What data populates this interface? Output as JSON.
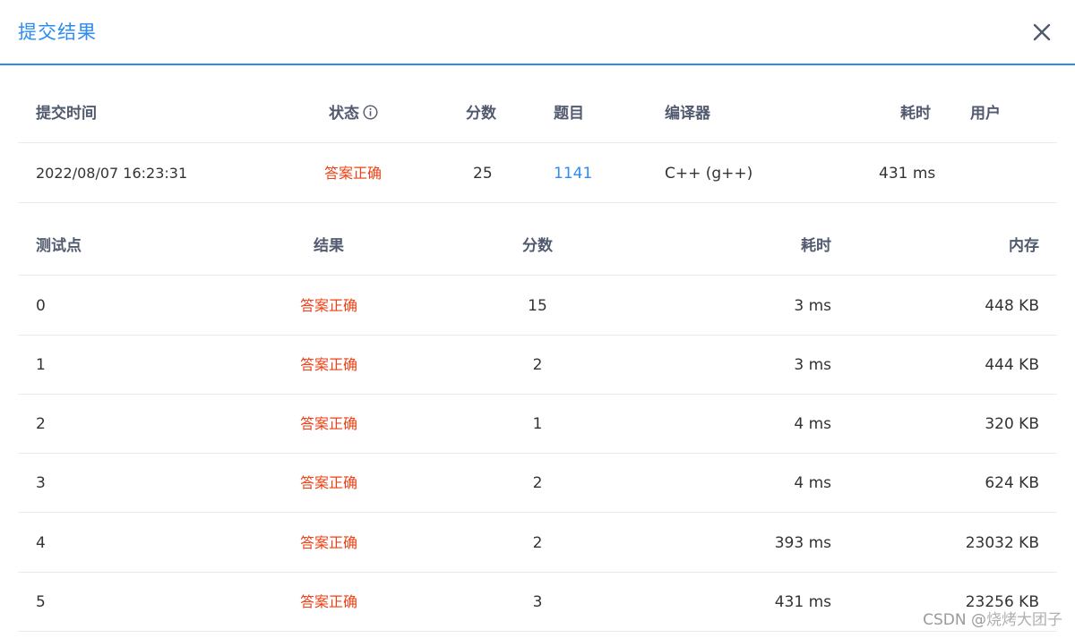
{
  "dialog": {
    "title": "提交结果",
    "close_icon": "close-icon"
  },
  "submission": {
    "headers": {
      "time": "提交时间",
      "status": "状态",
      "score": "分数",
      "problem": "题目",
      "compiler": "编译器",
      "time_cost": "耗时",
      "user": "用户"
    },
    "status_info_icon": "info-icon",
    "row": {
      "time": "2022/08/07 16:23:31",
      "status": "答案正确",
      "score": "25",
      "problem": "1141",
      "compiler": "C++ (g++)",
      "time_cost": "431 ms",
      "user": ""
    }
  },
  "testcases": {
    "headers": {
      "case": "测试点",
      "result": "结果",
      "score": "分数",
      "time": "耗时",
      "memory": "内存"
    },
    "rows": [
      {
        "case": "0",
        "result": "答案正确",
        "score": "15",
        "time": "3 ms",
        "memory": "448 KB"
      },
      {
        "case": "1",
        "result": "答案正确",
        "score": "2",
        "time": "3 ms",
        "memory": "444 KB"
      },
      {
        "case": "2",
        "result": "答案正确",
        "score": "1",
        "time": "4 ms",
        "memory": "320 KB"
      },
      {
        "case": "3",
        "result": "答案正确",
        "score": "2",
        "time": "4 ms",
        "memory": "624 KB"
      },
      {
        "case": "4",
        "result": "答案正确",
        "score": "2",
        "time": "393 ms",
        "memory": "23032 KB"
      },
      {
        "case": "5",
        "result": "答案正确",
        "score": "3",
        "time": "431 ms",
        "memory": "23256 KB"
      }
    ]
  },
  "watermark": {
    "source": "CSDN @",
    "name": "烧烤大团子"
  },
  "colors": {
    "accent": "#2d8cf0",
    "success_text": "#ed4014",
    "divider": "#e8eaec"
  }
}
